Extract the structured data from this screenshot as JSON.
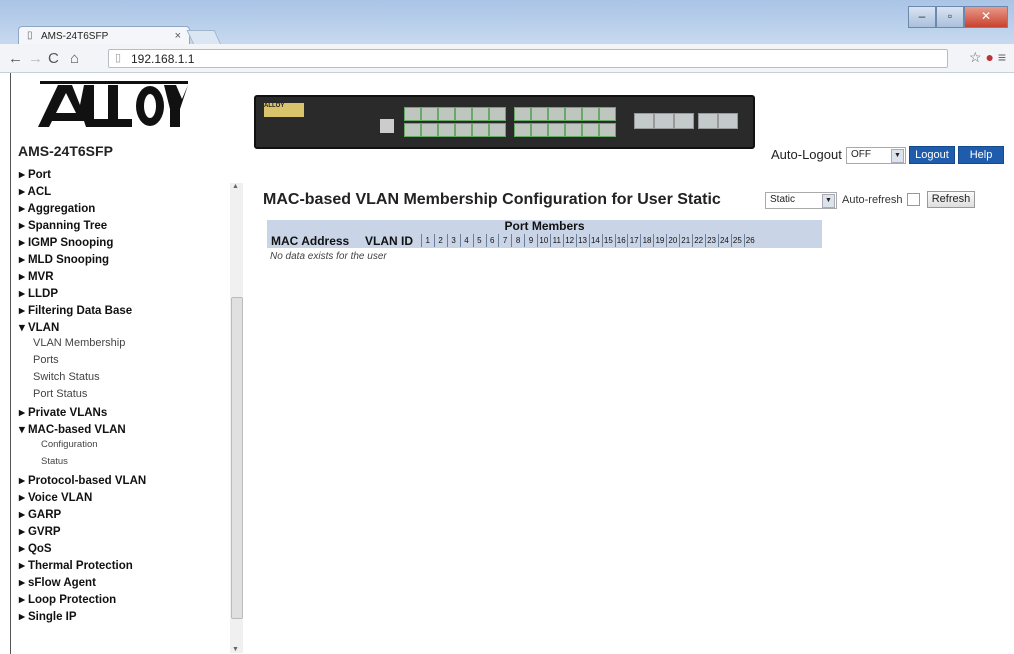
{
  "browser": {
    "tab_title": "AMS-24T6SFP",
    "tab_close": "×",
    "url": "192.168.1.1"
  },
  "header": {
    "logo_text": "ALLOY",
    "model": "AMS-24T6SFP",
    "auto_logout_label": "Auto-Logout",
    "auto_logout_value": "OFF",
    "logout_button": "Logout",
    "help_button": "Help"
  },
  "sidebar": {
    "items": [
      {
        "label": "▸ Port",
        "level": "b"
      },
      {
        "label": "▸ ACL",
        "level": "b"
      },
      {
        "label": "▸ Aggregation",
        "level": "b"
      },
      {
        "label": "▸ Spanning Tree",
        "level": "b"
      },
      {
        "label": "▸ IGMP Snooping",
        "level": "b"
      },
      {
        "label": "▸ MLD Snooping",
        "level": "b"
      },
      {
        "label": "▸ MVR",
        "level": "b"
      },
      {
        "label": "▸ LLDP",
        "level": "b"
      },
      {
        "label": "▸ Filtering Data Base",
        "level": "b"
      },
      {
        "label": "▾ VLAN",
        "level": "b"
      },
      {
        "label": "VLAN Membership",
        "level": "s"
      },
      {
        "label": "Ports",
        "level": "s"
      },
      {
        "label": "Switch Status",
        "level": "s"
      },
      {
        "label": "Port Status",
        "level": "s"
      },
      {
        "label": "▸ Private VLANs",
        "level": "b"
      },
      {
        "label": "▾ MAC-based VLAN",
        "level": "b"
      },
      {
        "label": "Configuration",
        "level": "xs"
      },
      {
        "label": "Status",
        "level": "xs"
      },
      {
        "label": "▸ Protocol-based VLAN",
        "level": "b"
      },
      {
        "label": "▸ Voice VLAN",
        "level": "b"
      },
      {
        "label": "▸ GARP",
        "level": "b"
      },
      {
        "label": "▸ GVRP",
        "level": "b"
      },
      {
        "label": "▸ QoS",
        "level": "b"
      },
      {
        "label": "▸ Thermal Protection",
        "level": "b"
      },
      {
        "label": "▸ sFlow Agent",
        "level": "b"
      },
      {
        "label": "▸ Loop Protection",
        "level": "b"
      },
      {
        "label": "▸ Single IP",
        "level": "b"
      }
    ]
  },
  "main": {
    "title": "MAC-based VLAN Membership Configuration for User Static",
    "user_select": "Static",
    "auto_refresh_label": "Auto-refresh",
    "refresh_button": "Refresh",
    "table": {
      "group_header": "Port Members",
      "col_mac": "MAC Address",
      "col_vlan": "VLAN ID",
      "ports": [
        "1",
        "2",
        "3",
        "4",
        "5",
        "6",
        "7",
        "8",
        "9",
        "10",
        "11",
        "12",
        "13",
        "14",
        "15",
        "16",
        "17",
        "18",
        "19",
        "20",
        "21",
        "22",
        "23",
        "24",
        "25",
        "26"
      ],
      "empty_message": "No data exists for the user"
    }
  }
}
